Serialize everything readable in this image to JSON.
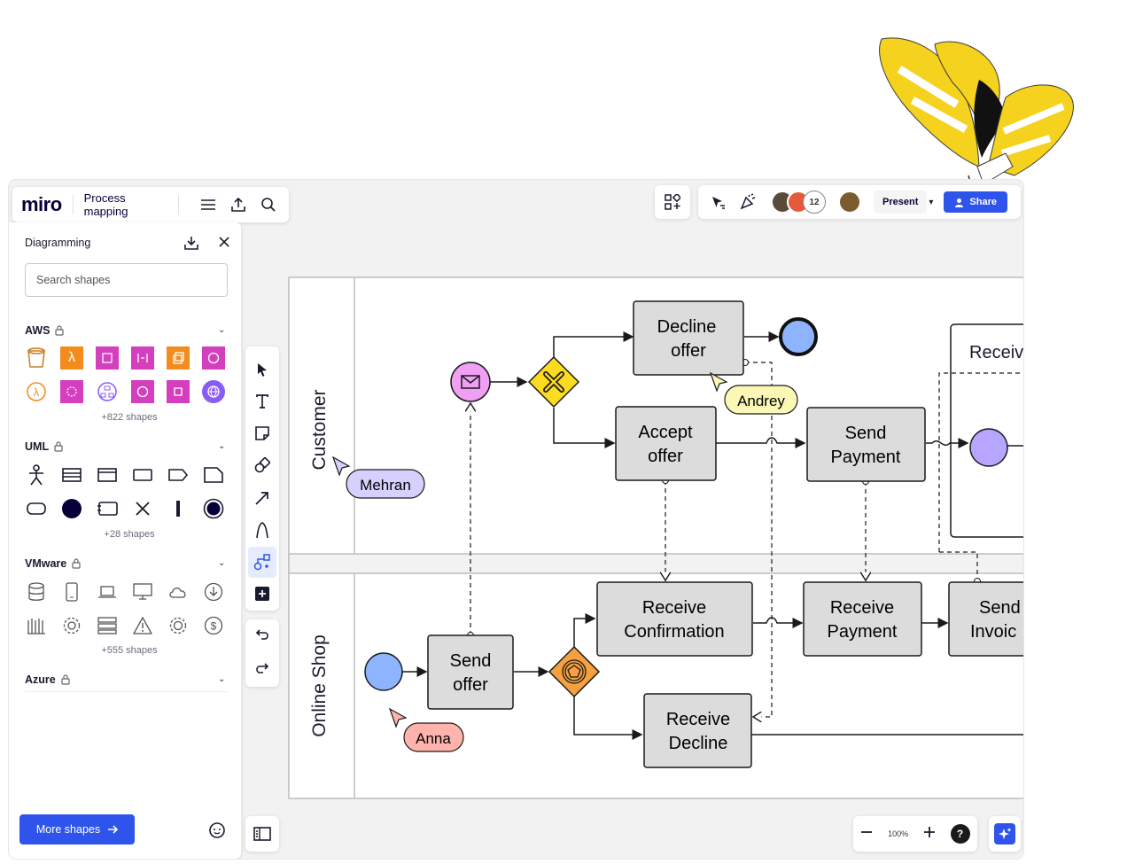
{
  "app": {
    "logo": "miro",
    "board_name": "Process mapping"
  },
  "topbar_right": {
    "participants_count": "12",
    "present_label": "Present",
    "share_label": "Share"
  },
  "sidebar": {
    "title": "Diagramming",
    "search_placeholder": "Search shapes",
    "sections": [
      {
        "name": "AWS",
        "locked": true,
        "more": "+822 shapes"
      },
      {
        "name": "UML",
        "locked": true,
        "more": "+28 shapes"
      },
      {
        "name": "VMware",
        "locked": true,
        "more": "+555 shapes"
      },
      {
        "name": "Azure",
        "locked": true,
        "more": ""
      }
    ],
    "more_shapes_label": "More shapes"
  },
  "toolbar": {
    "tools": [
      "select-tool",
      "text-tool",
      "sticky-note-tool",
      "shapes-tool",
      "connector-tool",
      "pen-tool",
      "diagramming-tool",
      "add-more-tool"
    ]
  },
  "zoom": {
    "level": "100%"
  },
  "help_label": "?",
  "diagram": {
    "lanes": [
      {
        "name": "Customer"
      },
      {
        "name": "Online Shop"
      }
    ],
    "nodes": {
      "decline_offer": [
        "Decline",
        "offer"
      ],
      "accept_offer": [
        "Accept",
        "offer"
      ],
      "send_payment": [
        "Send",
        "Payment"
      ],
      "receive_partial": "Receiv",
      "receive_confirmation": [
        "Receive",
        "Confirmation"
      ],
      "receive_payment": [
        "Receive",
        "Payment"
      ],
      "send_invoice_partial": [
        "Send",
        "Invoic"
      ],
      "send_offer": [
        "Send",
        "offer"
      ],
      "receive_decline": [
        "Receive",
        "Decline"
      ]
    },
    "cursors": [
      "Andrey",
      "Mehran",
      "Anna"
    ]
  },
  "colors": {
    "accent": "#2f54eb",
    "task_fill": "#dcdcdc",
    "end_event": "#8fb4ff",
    "intermediate_event": "#b6a6ff",
    "message_event": "#f09ff5",
    "gateway_exclusive": "#fcdc1e",
    "gateway_event": "#f6a040",
    "cursor_andrey": "#fbf7b4",
    "cursor_mehran": "#d6d0ff",
    "cursor_anna": "#ffb3ad"
  }
}
